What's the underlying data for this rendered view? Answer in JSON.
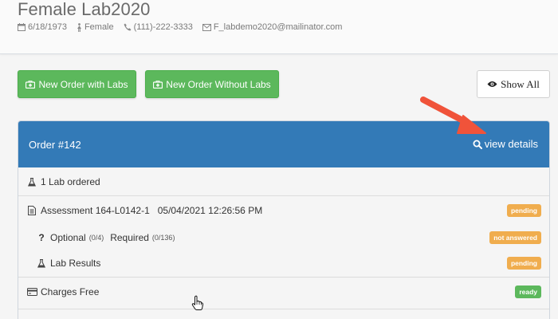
{
  "patient": {
    "name": "Female Lab2020",
    "dob": "6/18/1973",
    "gender": "Female",
    "phone": "(111)-222-3333",
    "email": "F_labdemo2020@mailinator.com"
  },
  "actions": {
    "new_with_labs": "New Order with Labs",
    "new_without_labs": "New Order Without Labs",
    "show_all": "Show All"
  },
  "order": {
    "title": "Order #142",
    "view_details": "view details",
    "labs_ordered": "1 Lab ordered",
    "assessment": {
      "name": "Assessment 164-L0142-1",
      "datetime": "05/04/2021 12:26:56 PM",
      "status": "pending"
    },
    "questionnaire": {
      "optional_label": "Optional",
      "optional_count": "(0/4)",
      "required_label": "Required",
      "required_count": "(0/136)",
      "status": "not answered"
    },
    "lab_results": {
      "label": "Lab Results",
      "status": "pending"
    },
    "charges": {
      "label": "Charges Free",
      "status": "ready"
    }
  },
  "colors": {
    "primary": "#337ab7",
    "success": "#5cb85c",
    "warning": "#f0ad4e",
    "arrow": "#f0533a"
  },
  "icons": [
    "calendar-icon",
    "female-icon",
    "phone-icon",
    "envelope-icon",
    "medkit-icon",
    "eye-icon",
    "search-icon",
    "flask-icon",
    "document-icon",
    "question-icon",
    "credit-card-icon",
    "hand-cursor-icon"
  ]
}
